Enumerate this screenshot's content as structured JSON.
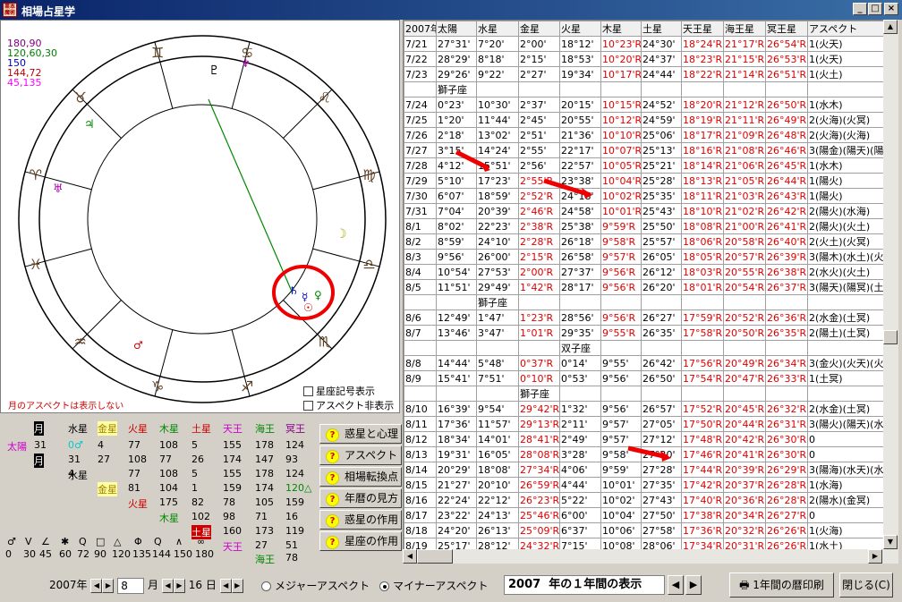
{
  "window": {
    "title": "相場占星学",
    "app_icon_text": "業本魔術",
    "min": "_",
    "max": "□",
    "close": "×"
  },
  "legend": [
    {
      "text": "180,90",
      "color": "#800080"
    },
    {
      "text": "120,60,30",
      "color": "#008000"
    },
    {
      "text": "150",
      "color": "#0000c0"
    },
    {
      "text": "144,72",
      "color": "#c00000"
    },
    {
      "text": "45,135",
      "color": "#ff00ff"
    }
  ],
  "moon_note": "月のアスペクトは表示しない",
  "checkboxes": {
    "show_sign_symbols": "星座記号表示",
    "hide_aspects": "アスペクト非表示"
  },
  "aspect_grid": {
    "col_headers": [
      "水星",
      "金星",
      "火星",
      "木星",
      "土星",
      "天王",
      "海王",
      "冥王"
    ],
    "row_sun": "太陽",
    "row_moon_label": "月",
    "sun_values": [
      "31",
      "",
      "",
      "",
      "",
      "",
      "",
      ""
    ],
    "row1": [
      "0♂",
      "4",
      "77",
      "108",
      "5",
      "155",
      "178",
      "124"
    ],
    "row2": [
      "31",
      "27",
      "108",
      "77",
      "26",
      "174",
      "147",
      "93"
    ],
    "row3": [
      "4",
      "",
      "77",
      "108",
      "5",
      "155",
      "178",
      "124"
    ],
    "row4_label": "金星",
    "row4": [
      "81",
      "104",
      "1",
      "159",
      "174",
      "120△"
    ],
    "row5_label": "火星",
    "row5": [
      "175",
      "82",
      "78",
      "105",
      "159"
    ],
    "row6_label": "木星",
    "row6": [
      "102",
      "98",
      "71",
      "16"
    ],
    "row7_label": "土星",
    "row7": [
      "160",
      "173",
      "119"
    ],
    "row8_label": "天王",
    "row8": [
      "27",
      "51"
    ],
    "row9_label": "海王",
    "row9": [
      "78"
    ],
    "mercury_label": "水星",
    "aspect_symbols": [
      "♂",
      "V",
      "∠",
      "✱",
      "Q",
      "□",
      "△",
      "Φ",
      "Q",
      "∧",
      "∞"
    ],
    "aspect_degrees": [
      "0",
      "30",
      "45",
      "60",
      "72",
      "90",
      "120",
      "135",
      "144",
      "150",
      "180"
    ]
  },
  "help_buttons": [
    "惑星と心理",
    "アスペクト",
    "相場転換点",
    "年暦の見方",
    "惑星の作用",
    "星座の作用"
  ],
  "table": {
    "headers": [
      "2007年",
      "太陽",
      "水星",
      "金星",
      "火星",
      "木星",
      "土星",
      "天王星",
      "海王星",
      "冥王星",
      "アスペクト"
    ],
    "rows": [
      {
        "d": "7/21",
        "c": [
          "27°31'",
          "7°20'",
          "2°00'",
          "18°12'",
          "10°23'R",
          "24°30'",
          "18°24'R",
          "21°17'R",
          "26°54'R",
          "1(火天)"
        ]
      },
      {
        "d": "7/22",
        "c": [
          "28°29'",
          "8°18'",
          "2°15'",
          "18°53'",
          "10°20'R",
          "24°37'",
          "18°23'R",
          "21°15'R",
          "26°53'R",
          "1(火天)"
        ]
      },
      {
        "d": "7/23",
        "c": [
          "29°26'",
          "9°22'",
          "2°27'",
          "19°34'",
          "10°17'R",
          "24°44'",
          "18°22'R",
          "21°14'R",
          "26°51'R",
          "1(火土)"
        ]
      },
      {
        "d": "",
        "sign": "獅子座"
      },
      {
        "d": "7/24",
        "c": [
          "0°23'",
          "10°30'",
          "2°37'",
          "20°15'",
          "10°15'R",
          "24°52'",
          "18°20'R",
          "21°12'R",
          "26°50'R",
          "1(水木)"
        ]
      },
      {
        "d": "7/25",
        "c": [
          "1°20'",
          "11°44'",
          "2°45'",
          "20°55'",
          "10°12'R",
          "24°59'",
          "18°19'R",
          "21°11'R",
          "26°49'R",
          "2(火海)(火冥)"
        ]
      },
      {
        "d": "7/26",
        "c": [
          "2°18'",
          "13°02'",
          "2°51'",
          "21°36'",
          "10°10'R",
          "25°06'",
          "18°17'R",
          "21°09'R",
          "26°48'R",
          "2(火海)(火海)"
        ]
      },
      {
        "d": "7/27",
        "c": [
          "3°15'",
          "14°24'",
          "2°55'",
          "22°17'",
          "10°07'R",
          "25°13'",
          "18°16'R",
          "21°08'R",
          "26°46'R",
          "3(陽金)(陽天)(陽"
        ]
      },
      {
        "d": "7/28",
        "c": [
          "4°12'",
          "15°51'",
          "2°56'",
          "22°57'",
          "10°05'R",
          "25°21'",
          "18°14'R",
          "21°06'R",
          "26°45'R",
          "1(水木)"
        ]
      },
      {
        "d": "7/29",
        "c": [
          "5°10'",
          "17°23'",
          "2°55'R",
          "23°38'",
          "10°04'R",
          "25°28'",
          "18°13'R",
          "21°05'R",
          "26°44'R",
          "1(陽火)"
        ]
      },
      {
        "d": "7/30",
        "c": [
          "6°07'",
          "18°59'",
          "2°52'R",
          "24°18'",
          "10°02'R",
          "25°35'",
          "18°11'R",
          "21°03'R",
          "26°43'R",
          "1(陽火)"
        ]
      },
      {
        "d": "7/31",
        "c": [
          "7°04'",
          "20°39'",
          "2°46'R",
          "24°58'",
          "10°01'R",
          "25°43'",
          "18°10'R",
          "21°02'R",
          "26°42'R",
          "2(陽火)(水海)"
        ]
      },
      {
        "d": "8/1",
        "c": [
          "8°02'",
          "22°23'",
          "2°38'R",
          "25°38'",
          "9°59'R",
          "25°50'",
          "18°08'R",
          "21°00'R",
          "26°41'R",
          "2(陽火)(火土)"
        ]
      },
      {
        "d": "8/2",
        "c": [
          "8°59'",
          "24°10'",
          "2°28'R",
          "26°18'",
          "9°58'R",
          "25°57'",
          "18°06'R",
          "20°58'R",
          "26°40'R",
          "2(火土)(火冥)"
        ]
      },
      {
        "d": "8/3",
        "c": [
          "9°56'",
          "26°00'",
          "2°15'R",
          "26°58'",
          "9°57'R",
          "26°05'",
          "18°05'R",
          "20°57'R",
          "26°39'R",
          "3(陽木)(水土)(火"
        ]
      },
      {
        "d": "8/4",
        "c": [
          "10°54'",
          "27°53'",
          "2°00'R",
          "27°37'",
          "9°56'R",
          "26°12'",
          "18°03'R",
          "20°55'R",
          "26°38'R",
          "2(水火)(火土)"
        ]
      },
      {
        "d": "8/5",
        "c": [
          "11°51'",
          "29°49'",
          "1°42'R",
          "28°17'",
          "9°56'R",
          "26°20'",
          "18°01'R",
          "20°54'R",
          "26°37'R",
          "3(陽天)(陽冥)(土"
        ]
      },
      {
        "d": "",
        "sign": "獅子座",
        "signcol": 2
      },
      {
        "d": "8/6",
        "c": [
          "12°49'",
          "1°47'",
          "1°23'R",
          "28°56'",
          "9°56'R",
          "26°27'",
          "17°59'R",
          "20°52'R",
          "26°36'R",
          "2(水金)(土冥)"
        ]
      },
      {
        "d": "8/7",
        "c": [
          "13°46'",
          "3°47'",
          "1°01'R",
          "29°35'",
          "9°55'R",
          "26°35'",
          "17°58'R",
          "20°50'R",
          "26°35'R",
          "2(陽土)(土冥)"
        ]
      },
      {
        "d": "",
        "sign": "双子座",
        "signcol": 4
      },
      {
        "d": "8/8",
        "c": [
          "14°44'",
          "5°48'",
          "0°37'R",
          "0°14'",
          "9°55'",
          "26°42'",
          "17°56'R",
          "20°49'R",
          "26°34'R",
          "3(金火)(火天)(火"
        ]
      },
      {
        "d": "8/9",
        "c": [
          "15°41'",
          "7°51'",
          "0°10'R",
          "0°53'",
          "9°56'",
          "26°50'",
          "17°54'R",
          "20°47'R",
          "26°33'R",
          "1(土冥)"
        ]
      },
      {
        "d": "",
        "sign": "獅子座",
        "signcol": 3
      },
      {
        "d": "8/10",
        "c": [
          "16°39'",
          "9°54'",
          "29°42'R",
          "1°32'",
          "9°56'",
          "26°57'",
          "17°52'R",
          "20°45'R",
          "26°32'R",
          "2(水金)(土冥)"
        ]
      },
      {
        "d": "8/11",
        "c": [
          "17°36'",
          "11°57'",
          "29°13'R",
          "2°11'",
          "9°57'",
          "27°05'",
          "17°50'R",
          "20°44'R",
          "26°31'R",
          "3(陽火)(陽天)(水"
        ]
      },
      {
        "d": "8/12",
        "c": [
          "18°34'",
          "14°01'",
          "28°41'R",
          "2°49'",
          "9°57'",
          "27°12'",
          "17°48'R",
          "20°42'R",
          "26°30'R",
          "0"
        ]
      },
      {
        "d": "8/13",
        "c": [
          "19°31'",
          "16°05'",
          "28°08'R",
          "3°28'",
          "9°58'",
          "27°20'",
          "17°46'R",
          "20°41'R",
          "26°30'R",
          "0"
        ]
      },
      {
        "d": "8/14",
        "c": [
          "20°29'",
          "18°08'",
          "27°34'R",
          "4°06'",
          "9°59'",
          "27°28'",
          "17°44'R",
          "20°39'R",
          "26°29'R",
          "3(陽海)(水天)(水"
        ]
      },
      {
        "d": "8/15",
        "c": [
          "21°27'",
          "20°10'",
          "26°59'R",
          "4°44'",
          "10°01'",
          "27°35'",
          "17°42'R",
          "20°37'R",
          "26°28'R",
          "1(水海)"
        ]
      },
      {
        "d": "8/16",
        "c": [
          "22°24'",
          "22°12'",
          "26°23'R",
          "5°22'",
          "10°02'",
          "27°43'",
          "17°40'R",
          "20°36'R",
          "26°28'R",
          "2(陽水)(金冥)"
        ]
      },
      {
        "d": "8/17",
        "c": [
          "23°22'",
          "24°13'",
          "25°46'R",
          "6°00'",
          "10°04'",
          "27°50'",
          "17°38'R",
          "20°34'R",
          "26°27'R",
          "0"
        ]
      },
      {
        "d": "8/18",
        "c": [
          "24°20'",
          "26°13'",
          "25°09'R",
          "6°37'",
          "10°06'",
          "27°58'",
          "17°36'R",
          "20°32'R",
          "26°26'R",
          "1(火海)"
        ]
      },
      {
        "d": "8/19",
        "c": [
          "25°17'",
          "28°12'",
          "24°32'R",
          "7°15'",
          "10°08'",
          "28°06'",
          "17°34'R",
          "20°31'R",
          "26°26'R",
          "1(水土)"
        ]
      },
      {
        "d": "",
        "sign": "乙女座",
        "signcol": 2
      },
      {
        "d": "8/20",
        "c": [
          "26°15'",
          "0°10'",
          "23°55'R",
          "7°52'",
          "10°10'",
          "28°13'",
          "17°31'R",
          "20°29'R",
          "26°25'R",
          "1(陽冥)"
        ]
      }
    ]
  },
  "bottom": {
    "year": "2007",
    "year_unit": "年",
    "month": "8",
    "month_unit": "月",
    "day": "16",
    "day_unit": "日",
    "major_aspect": "メジャーアスペクト",
    "minor_aspect": "マイナーアスペクト",
    "year_display": "2007  年の１年間の表示",
    "print_button": "1年間の暦印刷",
    "close_button": "閉じる(C)"
  },
  "chart_signs": [
    "♈",
    "♉",
    "♊",
    "♋",
    "♌",
    "♍",
    "♎",
    "♏",
    "♐",
    "♑",
    "♒",
    "♓"
  ]
}
